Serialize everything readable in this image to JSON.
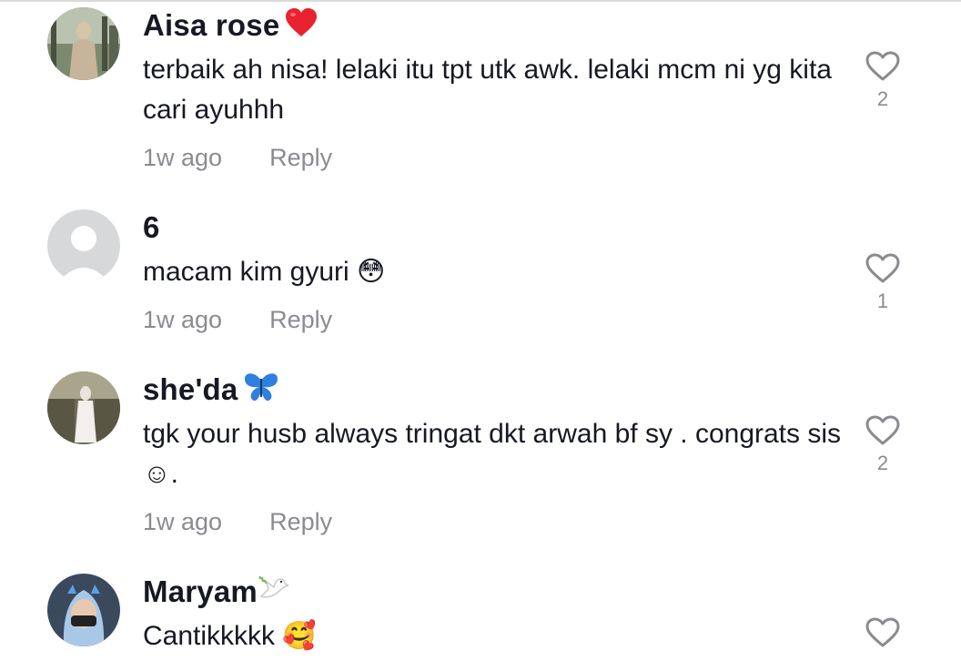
{
  "comments": [
    {
      "username": "Aisa rose",
      "username_emoji": "red-heart",
      "text": "terbaik ah nisa! lelaki itu tpt utk awk. lelaki mcm ni yg kita cari ayuhhh",
      "time": "1w ago",
      "reply_label": "Reply",
      "likes": "2"
    },
    {
      "username": "6",
      "text": "macam kim gyuri 😳",
      "time": "1w ago",
      "reply_label": "Reply",
      "likes": "1"
    },
    {
      "username": "she'da",
      "username_emoji": "butterfly",
      "text": "tgk your husb always tringat dkt arwah bf sy . congrats sis ☺.",
      "time": "1w ago",
      "reply_label": "Reply",
      "likes": "2"
    },
    {
      "username": "Maryam",
      "username_emoji": "dove",
      "text": "Cantikkkkk 🥰",
      "likes": ""
    }
  ],
  "colors": {
    "text": "#161823",
    "muted": "#8a8b91",
    "heart_outline": "#8a8b91",
    "divider": "#d9d9d9"
  }
}
